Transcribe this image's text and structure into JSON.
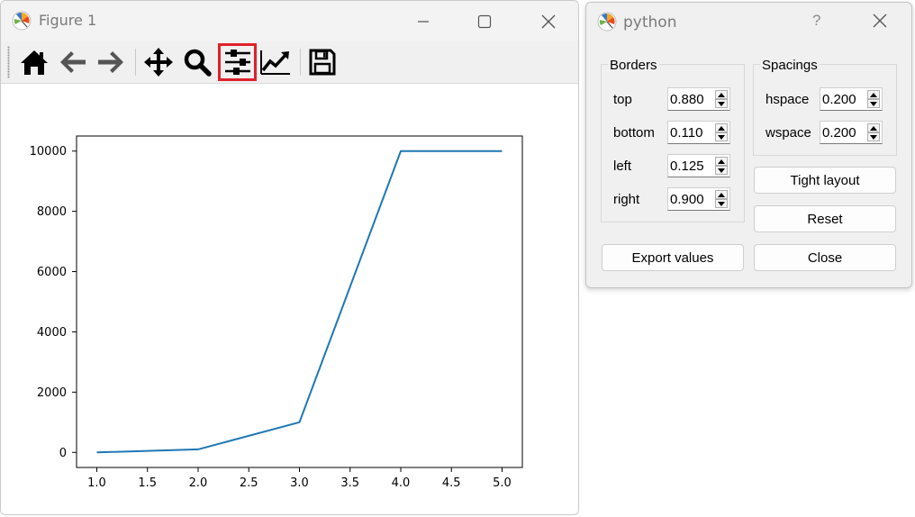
{
  "figure_window": {
    "title": "Figure 1",
    "icon": "matplotlib-icon",
    "controls": [
      "minimize-icon",
      "maximize-icon",
      "close-icon"
    ]
  },
  "toolbar": {
    "tools": [
      {
        "name": "home-icon"
      },
      {
        "name": "back-icon"
      },
      {
        "name": "forward-icon"
      },
      {
        "name": "pan-icon"
      },
      {
        "name": "zoom-icon"
      },
      {
        "name": "subplots-icon",
        "active": true
      },
      {
        "name": "customize-icon"
      },
      {
        "name": "save-icon"
      }
    ],
    "active_highlight_color": "#e0202a"
  },
  "chart_data": {
    "type": "line",
    "x": [
      1.0,
      2.0,
      3.0,
      4.0,
      5.0
    ],
    "series": [
      {
        "values": [
          0,
          100,
          1000,
          10000,
          10000
        ],
        "color": "#1f77b4"
      }
    ],
    "xlim": [
      0.8,
      5.2
    ],
    "ylim": [
      -500,
      10500
    ],
    "xticks": [
      1.0,
      1.5,
      2.0,
      2.5,
      3.0,
      3.5,
      4.0,
      4.5,
      5.0
    ],
    "xtick_labels": [
      "1.0",
      "1.5",
      "2.0",
      "2.5",
      "3.0",
      "3.5",
      "4.0",
      "4.5",
      "5.0"
    ],
    "yticks": [
      0,
      2000,
      4000,
      6000,
      8000,
      10000
    ],
    "ytick_labels": [
      "0",
      "2000",
      "4000",
      "6000",
      "8000",
      "10000"
    ],
    "grid": false,
    "title": "",
    "xlabel": "",
    "ylabel": ""
  },
  "dialog": {
    "title": "python",
    "help": "?",
    "borders_label": "Borders",
    "spacings_label": "Spacings",
    "borders": [
      {
        "label": "top",
        "value": "0.880"
      },
      {
        "label": "bottom",
        "value": "0.110"
      },
      {
        "label": "left",
        "value": "0.125"
      },
      {
        "label": "right",
        "value": "0.900"
      }
    ],
    "spacings": [
      {
        "label": "hspace",
        "value": "0.200"
      },
      {
        "label": "wspace",
        "value": "0.200"
      }
    ],
    "buttons": {
      "tight_layout": "Tight layout",
      "reset": "Reset",
      "export": "Export values",
      "close": "Close"
    }
  }
}
